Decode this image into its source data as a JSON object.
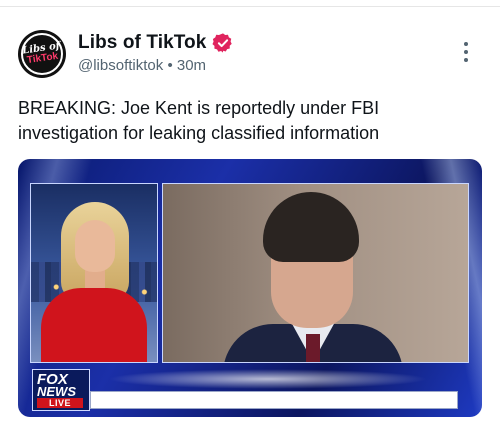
{
  "author": {
    "display_name": "Libs of TikTok",
    "handle": "@libsoftiktok",
    "separator": "•",
    "time": "30m",
    "avatar_logo_top": "Libs of",
    "avatar_logo_bottom": "TikTok",
    "verified_color": "#e0245e"
  },
  "tweet": {
    "text": "BREAKING: Joe Kent is reportedly under FBI investigation for leaking classified information"
  },
  "media": {
    "network_logo_line1": "FOX",
    "network_logo_line2": "NEWS",
    "live_badge": "LIVE"
  },
  "icons": {
    "more": "more-vertical-icon",
    "verified": "verified-badge-icon"
  }
}
